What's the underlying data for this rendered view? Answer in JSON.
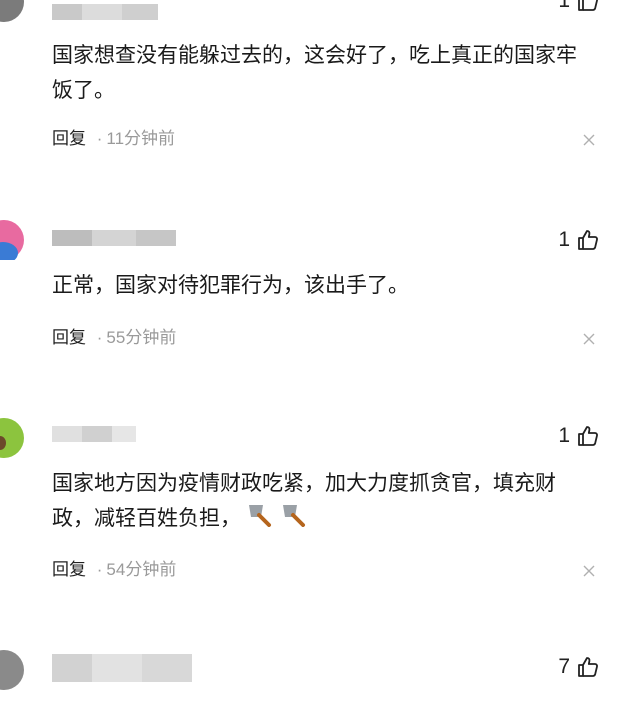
{
  "comments": [
    {
      "likes": "1",
      "text": "国家想查没有能躲过去的，这会好了，吃上真正的国家牢饭了。",
      "reply_label": "回复",
      "dot": "·",
      "time": "11分钟前",
      "avatar_color": "#7b7b7b"
    },
    {
      "likes": "1",
      "text": "正常，国家对待犯罪行为，该出手了。",
      "reply_label": "回复",
      "dot": "·",
      "time": "55分钟前",
      "avatar_color": "#e86aa0"
    },
    {
      "likes": "1",
      "text": "国家地方因为疫情财政吃紧，加大力度抓贪官，填充财政，减轻百姓负担，",
      "emoji": "cleaver-icon",
      "reply_label": "回复",
      "dot": "·",
      "time": "54分钟前",
      "avatar_color": "#8cc43e"
    },
    {
      "likes": "7",
      "avatar_color": "#8a8a8a"
    }
  ]
}
